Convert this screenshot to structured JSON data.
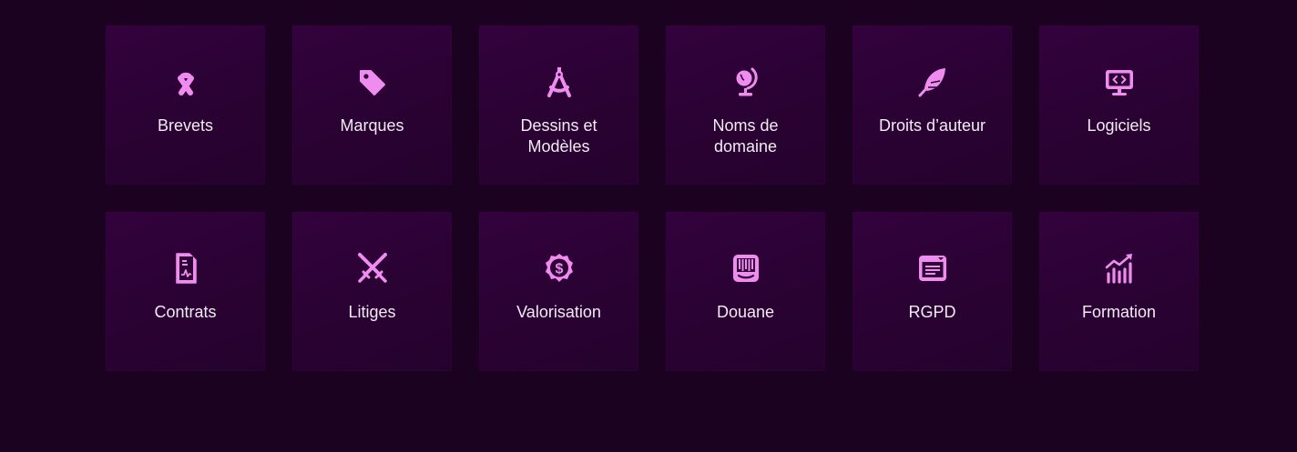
{
  "theme": {
    "background": "#1a0220",
    "tile": "#2d0235",
    "icon": "#f08cf0",
    "text": "#f3eaf5"
  },
  "services": [
    {
      "label": "Brevets",
      "icon": "ribbon-icon"
    },
    {
      "label": "Marques",
      "icon": "tag-icon"
    },
    {
      "label": "Dessins et\nModèles",
      "icon": "compass-drafting-icon"
    },
    {
      "label": "Noms de\ndomaine",
      "icon": "globe-stand-icon"
    },
    {
      "label": "Droits d’auteur",
      "icon": "feather-icon"
    },
    {
      "label": "Logiciels",
      "icon": "computer-code-icon"
    },
    {
      "label": "Contrats",
      "icon": "contract-file-icon"
    },
    {
      "label": "Litiges",
      "icon": "crossed-swords-icon"
    },
    {
      "label": "Valorisation",
      "icon": "dollar-badge-icon"
    },
    {
      "label": "Douane",
      "icon": "barcode-box-icon"
    },
    {
      "label": "RGPD",
      "icon": "privacy-window-icon"
    },
    {
      "label": "Formation",
      "icon": "chart-growth-icon"
    }
  ]
}
